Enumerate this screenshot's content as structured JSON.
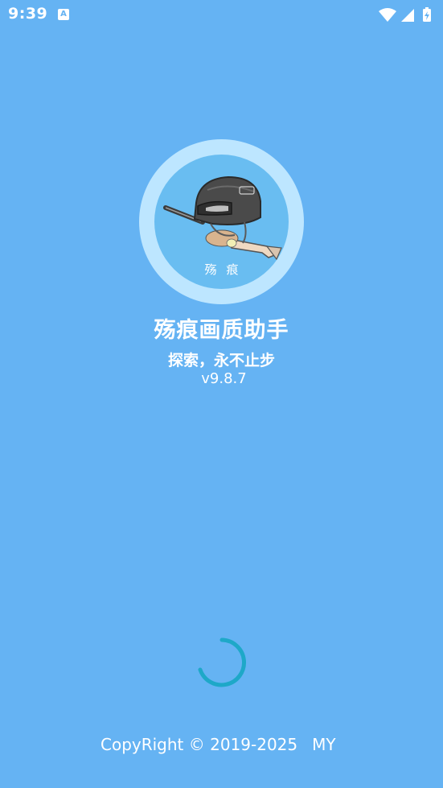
{
  "status_bar": {
    "time": "9:39",
    "notification_icon": "a-badge-icon",
    "notification_letter": "A",
    "icons": [
      "wifi-icon",
      "signal-icon",
      "battery-charging-icon"
    ]
  },
  "logo": {
    "icon": "helmet-soldier-rifle-emblem",
    "caption": "殇痕"
  },
  "app": {
    "name": "殇痕画质助手",
    "slogan": "探索，永不止步",
    "version": "v9.8.7"
  },
  "loading": {
    "icon": "loading-spinner-icon"
  },
  "footer": {
    "copyright": "CopyRight © 2019-2025",
    "author": "MY"
  },
  "colors": {
    "background": "#65b3f3",
    "logo_ring": "#bde6ff",
    "logo_fill": "#69bdf1",
    "spinner": "#1ea8c8",
    "text": "#ffffff"
  }
}
